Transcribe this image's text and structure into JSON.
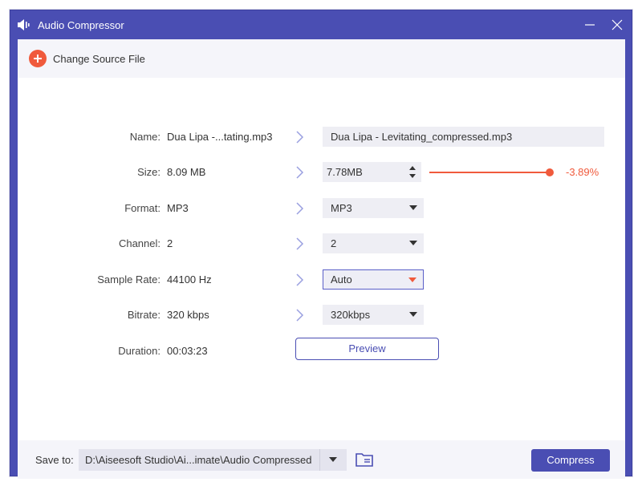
{
  "window": {
    "title": "Audio Compressor"
  },
  "topbar": {
    "change_source_label": "Change Source File"
  },
  "rows": {
    "name": {
      "label": "Name:",
      "original": "Dua Lipa -...tating.mp3",
      "output": "Dua Lipa - Levitating_compressed.mp3"
    },
    "size": {
      "label": "Size:",
      "original": "8.09 MB",
      "output": "7.78MB",
      "percent": "-3.89%",
      "slider_level_percent": 100
    },
    "format": {
      "label": "Format:",
      "original": "MP3",
      "selected": "MP3"
    },
    "channel": {
      "label": "Channel:",
      "original": "2",
      "selected": "2"
    },
    "sample_rate": {
      "label": "Sample Rate:",
      "original": "44100 Hz",
      "selected": "Auto"
    },
    "bitrate": {
      "label": "Bitrate:",
      "original": "320 kbps",
      "selected": "320kbps"
    },
    "duration": {
      "label": "Duration:",
      "original": "00:03:23",
      "preview_label": "Preview"
    }
  },
  "bottombar": {
    "save_label": "Save to:",
    "path": "D:\\Aiseesoft Studio\\Ai...imate\\Audio Compressed",
    "compress_label": "Compress"
  },
  "colors": {
    "accent": "#4a4eb3",
    "highlight": "#f05a3c"
  },
  "icons": [
    "audio-compressor-icon",
    "minimize-icon",
    "close-icon",
    "plus-icon",
    "chevron-right-icon",
    "spin-arrows-icon",
    "dropdown-caret-icon",
    "folder-icon"
  ]
}
